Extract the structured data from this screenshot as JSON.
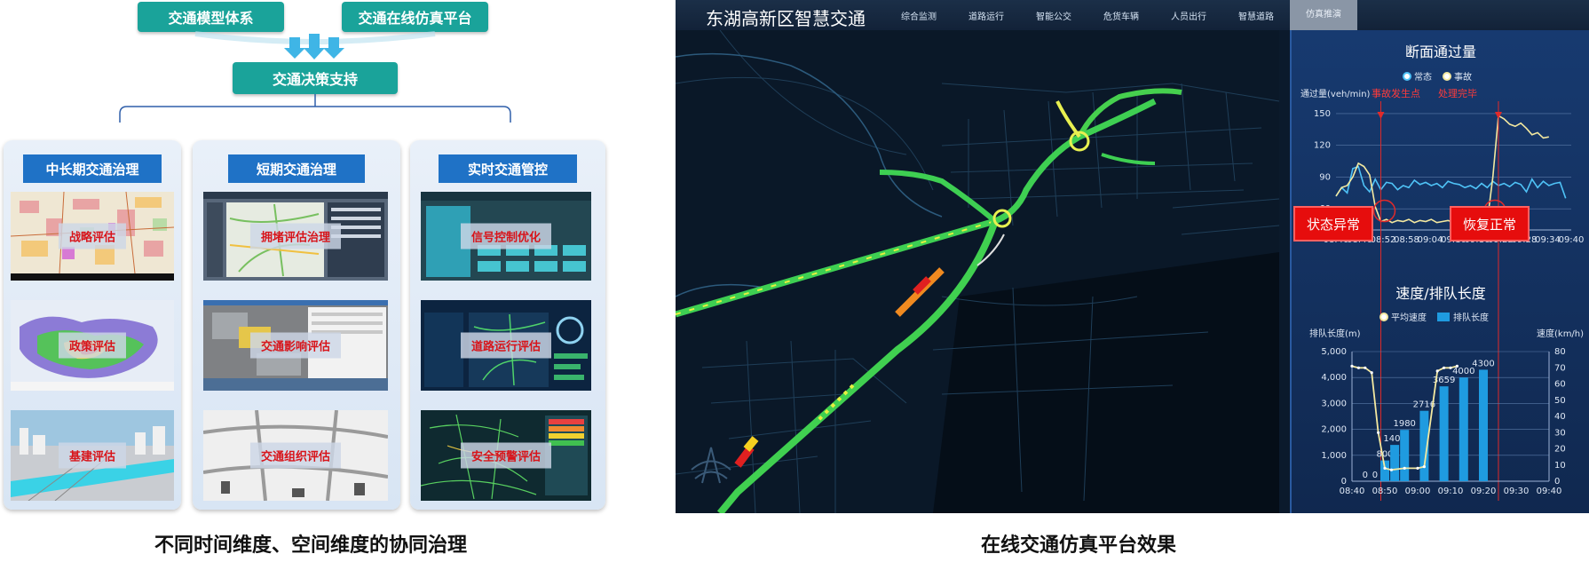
{
  "left": {
    "top_boxes": [
      "交通模型体系",
      "交通在线仿真平台"
    ],
    "decision_box": "交通决策支持",
    "columns": [
      {
        "title": "中长期交通治理",
        "thumbs": [
          "战略评估",
          "政策评估",
          "基建评估"
        ]
      },
      {
        "title": "短期交通治理",
        "thumbs": [
          "拥堵评估治理",
          "交通影响评估",
          "交通组织评估"
        ]
      },
      {
        "title": "实时交通管控",
        "thumbs": [
          "信号控制优化",
          "道路运行评估",
          "安全预警评估"
        ]
      }
    ],
    "caption": "不同时间维度、空间维度的协同治理"
  },
  "right": {
    "app_title": "东湖高新区智慧交通",
    "nav": [
      "综合监测",
      "道路运行",
      "智能公交",
      "危货车辆",
      "人员出行",
      "智慧道路",
      "仿真推演"
    ],
    "caption": "在线交通仿真平台效果"
  },
  "colors": {
    "teal": "#1aa39a",
    "col_title": "#1f72c6",
    "label_red": "#d8141a",
    "dashboard_bg": "#0e1d35",
    "panel_bg": "#17396e",
    "line_normal": "#4fc3f7",
    "line_incident": "#f4e9a0",
    "bar": "#1f9be0"
  },
  "chart_data": [
    {
      "type": "line",
      "title": "断面通过量",
      "ylabel": "通过量(veh/min)",
      "legend": [
        "常态",
        "事故"
      ],
      "x": [
        "08:40",
        "08:46",
        "08:52",
        "08:58",
        "09:04",
        "09:10",
        "09:16",
        "09:22",
        "09:28",
        "09:34",
        "09:40"
      ],
      "yticks": [
        60,
        90,
        120,
        150
      ],
      "ylim": [
        40,
        155
      ],
      "series": [
        {
          "name": "常态",
          "points": [
            [
              0,
              72
            ],
            [
              1,
              80
            ],
            [
              2,
              75
            ],
            [
              3,
              98
            ],
            [
              4,
              100
            ],
            [
              5,
              82
            ],
            [
              6,
              76
            ],
            [
              7,
              88
            ],
            [
              8,
              78
            ],
            [
              9,
              85
            ],
            [
              10,
              84
            ],
            [
              11,
              78
            ],
            [
              12,
              82
            ],
            [
              13,
              80
            ],
            [
              14,
              87
            ],
            [
              15,
              83
            ],
            [
              16,
              85
            ],
            [
              17,
              82
            ],
            [
              18,
              84
            ],
            [
              19,
              80
            ],
            [
              20,
              86
            ],
            [
              21,
              84
            ],
            [
              22,
              83
            ],
            [
              23,
              80
            ],
            [
              24,
              82
            ],
            [
              25,
              79
            ],
            [
              26,
              84
            ],
            [
              27,
              80
            ],
            [
              28,
              86
            ],
            [
              29,
              82
            ],
            [
              30,
              84
            ],
            [
              31,
              81
            ],
            [
              32,
              85
            ],
            [
              33,
              83
            ],
            [
              34,
              76
            ],
            [
              35,
              88
            ],
            [
              36,
              80
            ],
            [
              37,
              86
            ],
            [
              38,
              82
            ],
            [
              39,
              84
            ],
            [
              40,
              85
            ],
            [
              41,
              70
            ]
          ]
        },
        {
          "name": "事故",
          "points": [
            [
              0,
              72
            ],
            [
              1,
              80
            ],
            [
              2,
              82
            ],
            [
              3,
              90
            ],
            [
              4,
              103
            ],
            [
              5,
              100
            ],
            [
              6,
              92
            ],
            [
              7,
              62
            ],
            [
              8,
              48
            ],
            [
              9,
              50
            ],
            [
              10,
              47
            ],
            [
              11,
              49
            ],
            [
              12,
              48
            ],
            [
              13,
              50
            ],
            [
              14,
              47
            ],
            [
              15,
              49
            ],
            [
              16,
              48
            ],
            [
              17,
              50
            ],
            [
              18,
              47
            ],
            [
              19,
              48
            ],
            [
              20,
              49
            ],
            [
              21,
              47
            ],
            [
              22,
              49
            ],
            [
              23,
              50
            ],
            [
              24,
              48
            ],
            [
              25,
              49
            ],
            [
              26,
              50
            ],
            [
              27,
              48
            ],
            [
              28,
              90
            ],
            [
              29,
              148
            ],
            [
              30,
              145
            ],
            [
              31,
              140
            ],
            [
              32,
              138
            ],
            [
              33,
              141
            ],
            [
              34,
              136
            ],
            [
              35,
              130
            ],
            [
              36,
              132
            ],
            [
              37,
              127
            ],
            [
              38,
              128
            ]
          ]
        }
      ],
      "annotations": {
        "event_start": "事故发生点",
        "event_end": "处理完毕",
        "abnormal": "状态异常",
        "recovered": "恢复正常"
      }
    },
    {
      "type": "bar",
      "title": "速度/排队长度",
      "ylabel_left": "排队长度(m)",
      "ylabel_right": "速度(km/h)",
      "legend": [
        "平均速度",
        "排队长度"
      ],
      "x": [
        "08:40",
        "08:50",
        "09:00",
        "09:10",
        "09:20",
        "09:30",
        "09:40"
      ],
      "ylim_left": [
        0,
        5000
      ],
      "yticks_left": [
        "0",
        "1,000",
        "2,000",
        "3,000",
        "4,000",
        "5,000"
      ],
      "ylim_right": [
        0,
        80
      ],
      "yticks_right": [
        0,
        10,
        20,
        30,
        40,
        50,
        60,
        70,
        80
      ],
      "queue_series": [
        {
          "t": "08:44",
          "value": 0,
          "label": "0"
        },
        {
          "t": "08:47",
          "value": 0,
          "label": "0"
        },
        {
          "t": "08:50",
          "value": 800,
          "label": "800"
        },
        {
          "t": "08:53",
          "value": 1400,
          "label": "1400"
        },
        {
          "t": "08:56",
          "value": 1980,
          "label": "1980"
        },
        {
          "t": "09:02",
          "value": 2716,
          "label": "2716"
        },
        {
          "t": "09:08",
          "value": 3659,
          "label": "3659"
        },
        {
          "t": "09:14",
          "value": 4000,
          "label": "4000"
        },
        {
          "t": "09:20",
          "value": 4300,
          "label": "4300"
        }
      ],
      "speed_series": [
        [
          0,
          71
        ],
        [
          2,
          70
        ],
        [
          4,
          70
        ],
        [
          6,
          67
        ],
        [
          8,
          30
        ],
        [
          10,
          8
        ],
        [
          12,
          7
        ],
        [
          16,
          8
        ],
        [
          20,
          8
        ],
        [
          22,
          9
        ],
        [
          26,
          68
        ],
        [
          28,
          70
        ],
        [
          30,
          70
        ],
        [
          32,
          71
        ]
      ]
    }
  ]
}
